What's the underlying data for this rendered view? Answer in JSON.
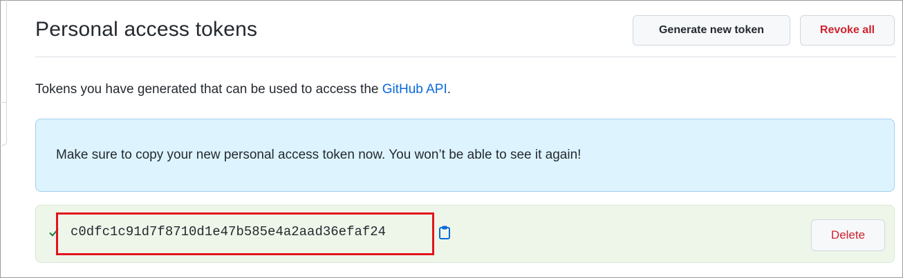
{
  "header": {
    "title": "Personal access tokens",
    "generate_label": "Generate new token",
    "revoke_label": "Revoke all"
  },
  "intro": {
    "text_before": "Tokens you have generated that can be used to access the ",
    "link_text": "GitHub API",
    "text_after": "."
  },
  "flash": {
    "message": "Make sure to copy your new personal access token now. You won’t be able to see it again!"
  },
  "token": {
    "value": "c0dfc1c91d7f8710d1e47b585e4a2aad36efaf24",
    "delete_label": "Delete",
    "status_icon": "check-icon",
    "copy_icon": "clipboard-icon"
  },
  "colors": {
    "link": "#0969da",
    "danger": "#cf222e",
    "success": "#1a7f37",
    "flash_bg": "#ddf4ff",
    "token_bg": "#eef6ea",
    "highlight": "#e2131c"
  }
}
